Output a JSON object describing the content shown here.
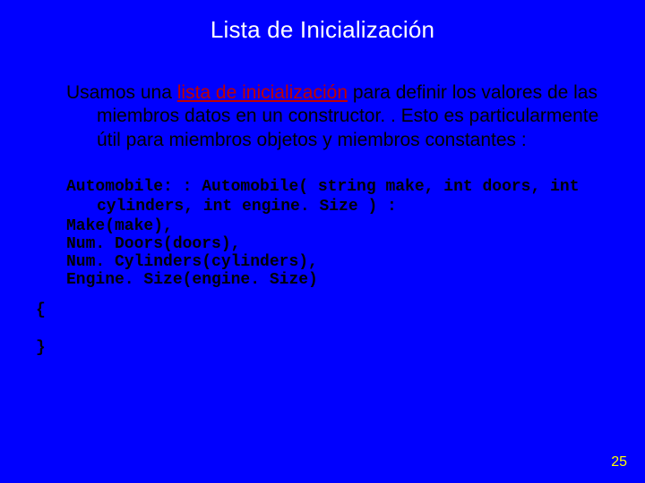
{
  "title": "Lista de Inicialización",
  "intro": {
    "pre": "Usamos una ",
    "highlight": "lista de inicialización",
    "post": " para definir los valores de las miembros datos en un constructor. . Esto es particularmente útil para miembros objetos y miembros constantes :"
  },
  "code": {
    "sig": "Automobile: : Automobile( string make, int doors, int cylinders, int engine. Size ) :",
    "l1": "Make(make),",
    "l2": "Num. Doors(doors),",
    "l3": "Num. Cylinders(cylinders),",
    "l4": "Engine. Size(engine. Size)",
    "open": "{",
    "close": "}"
  },
  "page": "25"
}
